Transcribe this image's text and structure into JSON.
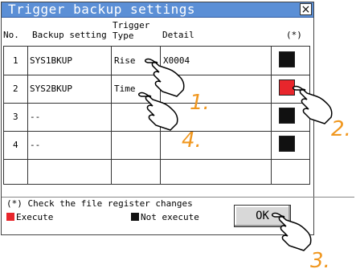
{
  "dialog": {
    "title": "Trigger backup settings",
    "close_label": "×"
  },
  "columns": {
    "no": "No.",
    "backup_setting": "Backup setting",
    "trigger_type_line1": "Trigger",
    "trigger_type_line2": "Type",
    "detail": "Detail",
    "asterisk": "(*)"
  },
  "rows": [
    {
      "no": "1",
      "backup_setting": "SYS1BKUP",
      "trigger_type": "Rise",
      "detail": "X0004",
      "check_state": "not_execute"
    },
    {
      "no": "2",
      "backup_setting": "SYS2BKUP",
      "trigger_type": "Time",
      "detail": "",
      "check_state": "execute"
    },
    {
      "no": "3",
      "backup_setting": "--",
      "trigger_type": "",
      "detail": "",
      "check_state": "not_execute"
    },
    {
      "no": "4",
      "backup_setting": "--",
      "trigger_type": "",
      "detail": "",
      "check_state": "not_execute"
    }
  ],
  "footer": {
    "note": "(*) Check the file register changes",
    "execute_label": "Execute",
    "not_execute_label": "Not execute",
    "ok_label": "OK"
  },
  "colors": {
    "title_bar": "#5b8fd6",
    "execute": "#e8262c",
    "not_execute": "#111111",
    "step_label": "#f0971f"
  },
  "annotations": {
    "step1": "1.",
    "step2": "2.",
    "step3": "3.",
    "step4": "4."
  }
}
